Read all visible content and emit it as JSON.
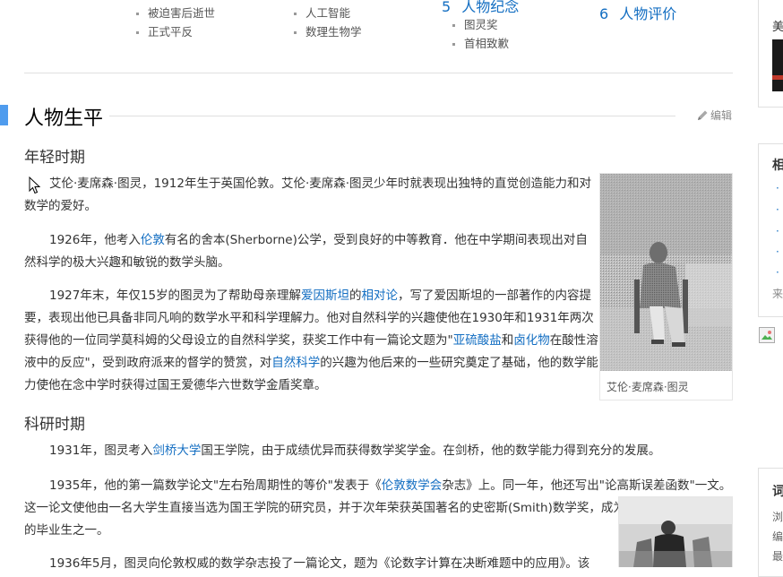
{
  "toc": {
    "col1": [
      "被迫害后逝世",
      "正式平反"
    ],
    "col2": [
      "人工智能",
      "数理生物学"
    ],
    "sec5": {
      "num": "5",
      "label": "人物纪念",
      "items": [
        "图灵奖",
        "首相致歉"
      ]
    },
    "sec6": {
      "num": "6",
      "label": "人物评价"
    }
  },
  "section": {
    "title": "人物生平",
    "edit_label": "编辑"
  },
  "youth": {
    "title": "年轻时期",
    "p1": "艾伦·麦席森·图灵，1912年生于英国伦敦。艾伦·麦席森·图灵少年时就表现出独特的直觉创造能力和对数学的爱好。",
    "p2a": "1926年，他考入",
    "p2link": "伦敦",
    "p2b": "有名的舍本(Sherborne)公学，受到良好的中等教育．他在中学期间表现出对自然科学的极大兴趣和敏锐的数学头脑。",
    "p3a": "1927年末，年仅15岁的图灵为了帮助母亲理解",
    "p3link1": "爱因斯坦",
    "p3b": "的",
    "p3link2": "相对论",
    "p3c": "，写了爱因斯坦的一部著作的内容提要，表现出他已具备非同凡响的数学水平和科学理解力。他对自然科学的兴趣使他在1930年和1931年两次获得他的一位同学莫科姆的父母设立的自然科学奖，获奖工作中有一篇论文题为\"",
    "p3link3": "亚硫酸盐",
    "p3d": "和",
    "p3link4": "卤化物",
    "p3e": "在酸性溶液中的反应\"，受到政府派来的督学的赞赏，对",
    "p3link5": "自然科学",
    "p3f": "的兴趣为他后来的一些研究奠定了基础，他的数学能力使他在念中学时获得过国王爱德华六世数学金盾奖章。",
    "photo_caption": "艾伦·麦席森·图灵"
  },
  "research": {
    "title": "科研时期",
    "p1a": "1931年，图灵考入",
    "p1link": "剑桥大学",
    "p1b": "国王学院，由于成绩优异而获得数学奖学金。在剑桥，他的数学能力得到充分的发展。",
    "p2a": "1935年，他的第一篇数学论文\"左右殆周期性的等价\"发表于《",
    "p2link": "伦敦数学会",
    "p2b": "杂志》上。同一年，他还写出\"论高斯误差函数\"一文。这一论文使他由一名大学生直接当选为国王学院的研究员，并于次年荣获英国著名的史密斯(Smith)数学奖，成为国王学院声名显赫的毕业生之一。",
    "p3": "1936年5月，图灵向伦敦权威的数学杂志投了一篇论文，题为《论数字计算在决断难题中的应用》。该"
  },
  "sidebar": {
    "top_text": "美",
    "box2_title": "相",
    "box2_more": "来",
    "box3_title": "词",
    "box3_lines": [
      "浏",
      "编",
      "最"
    ]
  },
  "colors": {
    "accent": "#4f9cee",
    "link": "#136ec2"
  }
}
